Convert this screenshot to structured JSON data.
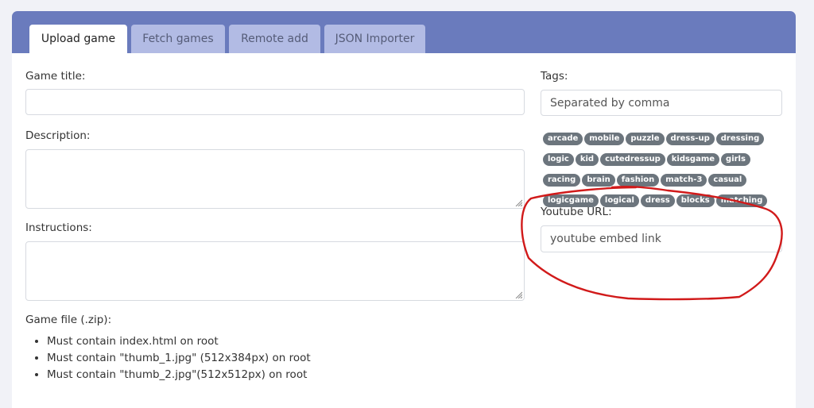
{
  "tabs": [
    {
      "label": "Upload game",
      "active": true
    },
    {
      "label": "Fetch games",
      "active": false
    },
    {
      "label": "Remote add",
      "active": false
    },
    {
      "label": "JSON Importer",
      "active": false
    }
  ],
  "form": {
    "title_label": "Game title:",
    "title_value": "",
    "description_label": "Description:",
    "description_value": "",
    "instructions_label": "Instructions:",
    "instructions_value": "",
    "file_label": "Game file (.zip):",
    "requirements": [
      "Must contain index.html on root",
      "Must contain \"thumb_1.jpg\" (512x384px) on root",
      "Must contain \"thumb_2.jpg\"(512x512px) on root"
    ]
  },
  "tags_section": {
    "label": "Tags:",
    "placeholder": "Separated by comma",
    "suggestions": [
      "arcade",
      "mobile",
      "puzzle",
      "dress-up",
      "dressing",
      "logic",
      "kid",
      "cutedressup",
      "kidsgame",
      "girls",
      "racing",
      "brain",
      "fashion",
      "match-3",
      "casual",
      "logicgame",
      "logical",
      "dress",
      "blocks",
      "matching"
    ]
  },
  "youtube": {
    "label": "Youtube URL:",
    "placeholder": "youtube embed link"
  },
  "colors": {
    "tabbar_bg": "#6a7bbd",
    "tab_inactive_bg": "#b2bbe4",
    "tag_bg": "#6c757d",
    "annotation": "#d11a1a"
  }
}
